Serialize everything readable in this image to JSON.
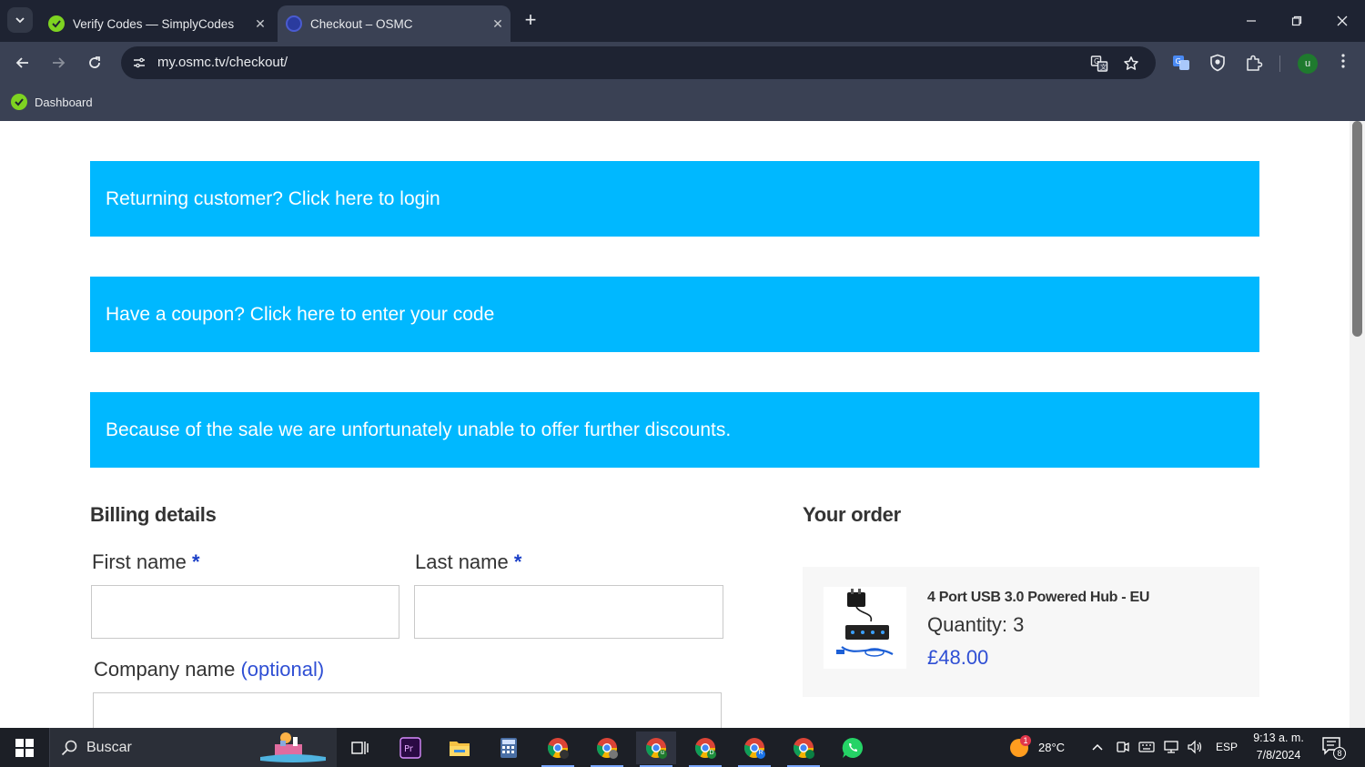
{
  "browser": {
    "tabs": [
      {
        "title": "Verify Codes — SimplyCodes",
        "favicon_color": "#7ed321",
        "active": false
      },
      {
        "title": "Checkout – OSMC",
        "favicon_color": "#2a3b9e",
        "active": true
      }
    ],
    "tab_close_glyph": "✕",
    "new_tab_glyph": "+",
    "url": "my.osmc.tv/checkout/",
    "profile_initial": "u",
    "bookmarks": [
      {
        "label": "Dashboard",
        "favicon_color": "#7ed321"
      }
    ],
    "icons": {
      "tab_search": "chevron-down-icon",
      "back": "back-arrow-icon",
      "forward": "forward-arrow-icon",
      "reload": "reload-icon",
      "site_info": "tune-icon",
      "translate": "translate-icon",
      "bookmark_star": "star-icon",
      "extensions": [
        "translate-extension-icon",
        "shield-extension-icon",
        "puzzle-icon"
      ],
      "menu": "more-vertical-icon"
    }
  },
  "page": {
    "notices": [
      {
        "text": "Returning customer? Click here to login"
      },
      {
        "text": "Have a coupon? Click here to enter your code"
      },
      {
        "text": "Because of the sale we are unfortunately unable to offer further discounts."
      }
    ],
    "notice_color": "#00b8ff",
    "billing": {
      "heading": "Billing details",
      "first_name_label": "First name",
      "last_name_label": "Last name",
      "required_mark": "*",
      "company_label": "Company name",
      "optional_text": "(optional)",
      "first_name_value": "",
      "last_name_value": "",
      "company_value": ""
    },
    "order": {
      "heading": "Your order",
      "items": [
        {
          "name": "4 Port USB 3.0 Powered Hub - EU",
          "quantity_text": "Quantity: 3",
          "price": "£48.00"
        }
      ]
    },
    "accent_color": "#2f4fd4"
  },
  "taskbar": {
    "search_text": "Buscar",
    "weather_temp": "28°C",
    "weather_badge": "1",
    "language": "ESP",
    "time": "9:13 a. m.",
    "date": "7/8/2024",
    "notification_count": "8",
    "apps": [
      "task-view-icon",
      "premiere-pro-icon",
      "file-explorer-icon",
      "calculator-icon",
      "chrome-profile-icon",
      "chrome-profile-icon",
      "chrome-profile-u-icon",
      "chrome-profile-d-icon",
      "chrome-profile-r-icon",
      "chrome-profile-icon",
      "whatsapp-icon"
    ],
    "chrome_badges": [
      "",
      "",
      "u",
      "D",
      "R",
      ""
    ]
  }
}
